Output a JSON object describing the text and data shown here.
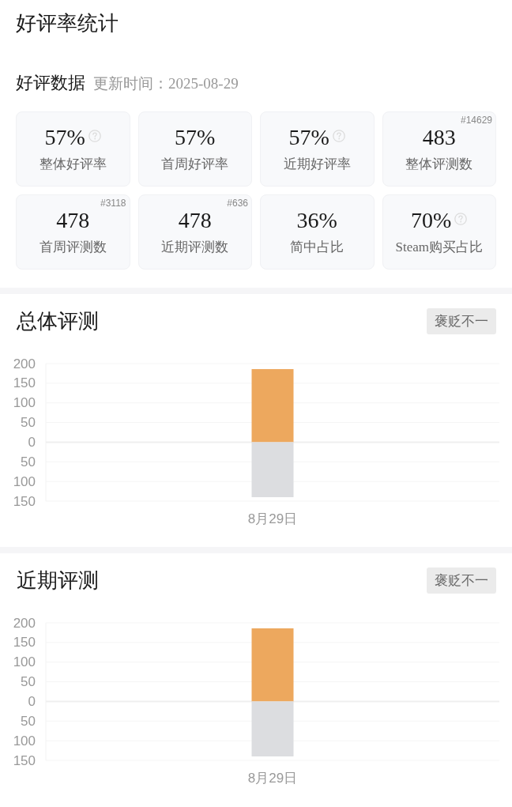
{
  "header": {
    "title": "好评率统计"
  },
  "summary": {
    "title": "好评数据",
    "updated": "更新时间：2025-08-29",
    "cards": [
      {
        "value": "57%",
        "label": "整体好评率",
        "help_icon": true
      },
      {
        "value": "57%",
        "label": "首周好评率",
        "help_icon": false
      },
      {
        "value": "57%",
        "label": "近期好评率",
        "help_icon": true
      },
      {
        "value": "483",
        "label": "整体评测数",
        "help_icon": false,
        "rank": "#14629"
      },
      {
        "value": "478",
        "label": "首周评测数",
        "help_icon": false,
        "rank": "#3118"
      },
      {
        "value": "478",
        "label": "近期评测数",
        "help_icon": false,
        "rank": "#636"
      },
      {
        "value": "36%",
        "label": "简中占比",
        "help_icon": false
      },
      {
        "value": "70%",
        "label": "Steam购买占比",
        "help_icon": true
      }
    ]
  },
  "sections": [
    {
      "title": "总体评测",
      "tag": "褒贬不一",
      "chart_data": {
        "type": "bar",
        "categories": [
          "8月29日"
        ],
        "series": [
          {
            "color": "#eda85e",
            "values": [
              186
            ]
          },
          {
            "color": "#dcdde0",
            "values": [
              -140
            ]
          }
        ],
        "stacked": true,
        "grid": true,
        "ylim": [
          -150,
          200
        ],
        "yticks": [
          200,
          150,
          100,
          50,
          0,
          {
            "value": -50,
            "label": "50"
          },
          {
            "value": -100,
            "label": "100"
          },
          {
            "value": -150,
            "label": "150"
          }
        ]
      }
    },
    {
      "title": "近期评测",
      "tag": "褒贬不一",
      "chart_data": {
        "type": "bar",
        "categories": [
          "8月29日"
        ],
        "series": [
          {
            "color": "#eda85e",
            "values": [
              186
            ]
          },
          {
            "color": "#dcdde0",
            "values": [
              -140
            ]
          }
        ],
        "stacked": true,
        "grid": true,
        "ylim": [
          -150,
          200
        ],
        "yticks": [
          200,
          150,
          100,
          50,
          0,
          {
            "value": -50,
            "label": "50"
          },
          {
            "value": -100,
            "label": "100"
          },
          {
            "value": -150,
            "label": "150"
          }
        ]
      }
    }
  ]
}
